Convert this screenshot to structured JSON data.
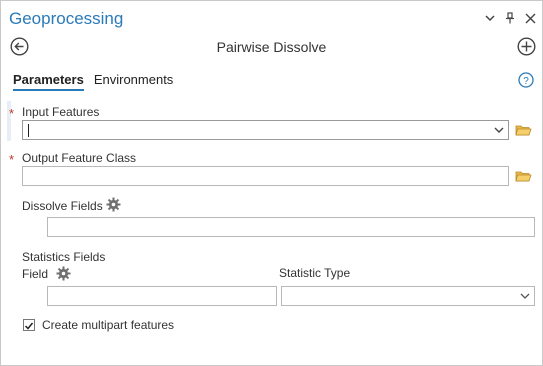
{
  "pane": {
    "title": "Geoprocessing",
    "controls": [
      "chevron-down-icon",
      "pin-icon",
      "close-icon"
    ]
  },
  "tool": {
    "name": "Pairwise Dissolve"
  },
  "tabs": [
    {
      "label": "Parameters",
      "active": true
    },
    {
      "label": "Environments",
      "active": false
    }
  ],
  "params": {
    "input_features": {
      "label": "Input Features",
      "required": true,
      "value": ""
    },
    "output_feature_class": {
      "label": "Output Feature Class",
      "required": true,
      "value": ""
    },
    "dissolve_fields": {
      "label": "Dissolve Fields",
      "value": ""
    },
    "statistics_fields": {
      "label": "Statistics Fields",
      "field_label": "Field",
      "field_value": "",
      "stat_type_label": "Statistic Type",
      "stat_type_value": ""
    },
    "multipart": {
      "label": "Create multipart features",
      "checked": true
    }
  },
  "colors": {
    "accent": "#2a7ab8",
    "required": "#c0392b",
    "folder": "#e8b84a"
  }
}
